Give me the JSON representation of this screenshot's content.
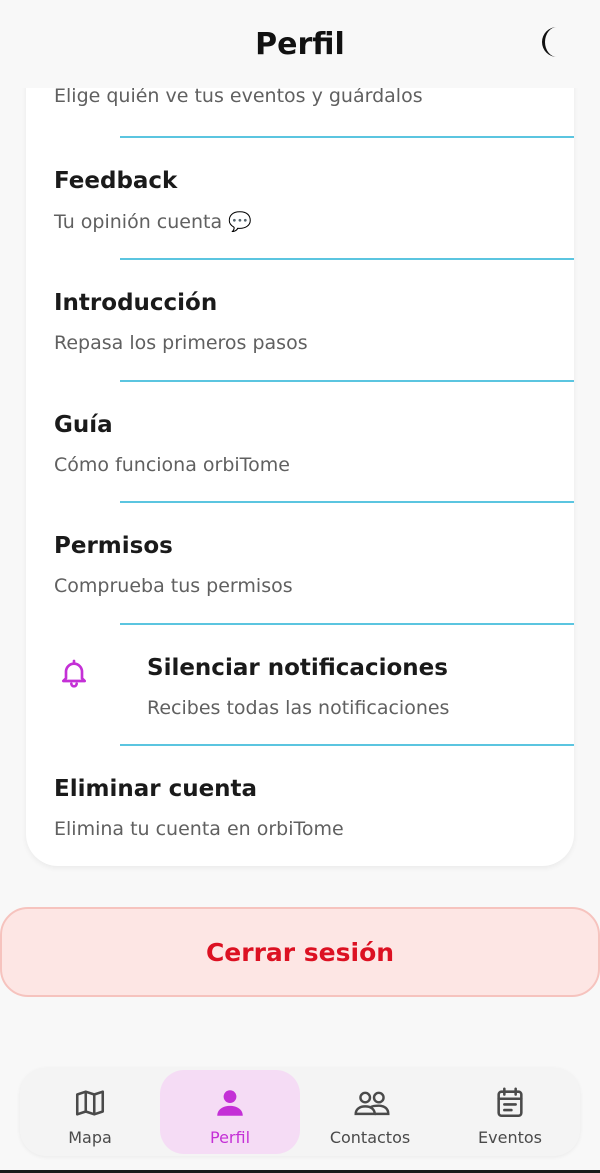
{
  "header": {
    "title": "Perfil",
    "theme_icon": "moon-icon"
  },
  "card": {
    "partial_subtitle": "Elige quién ve tus eventos y guárdalos",
    "items": [
      {
        "title": "Feedback",
        "subtitle": "Tu opinión cuenta 💬"
      },
      {
        "title": "Introducción",
        "subtitle": "Repasa los primeros pasos"
      },
      {
        "title": "Guía",
        "subtitle": "Cómo funciona orbiTome"
      },
      {
        "title": "Permisos",
        "subtitle": "Comprueba tus permisos"
      },
      {
        "title": "Silenciar notificaciones",
        "subtitle": "Recibes todas las notificaciones",
        "icon": "bell-icon"
      },
      {
        "title": "Eliminar cuenta",
        "subtitle": "Elimina tu cuenta en orbiTome"
      }
    ]
  },
  "logout": {
    "label": "Cerrar sesión"
  },
  "nav": {
    "items": [
      {
        "label": "Mapa",
        "icon": "map-icon"
      },
      {
        "label": "Perfil",
        "icon": "person-icon",
        "active": true
      },
      {
        "label": "Contactos",
        "icon": "contacts-icon"
      },
      {
        "label": "Eventos",
        "icon": "calendar-icon"
      }
    ]
  },
  "colors": {
    "accent": "#c430d6",
    "divider": "#5bc5e0",
    "danger": "#dc1122",
    "danger_bg": "#fde6e4"
  }
}
